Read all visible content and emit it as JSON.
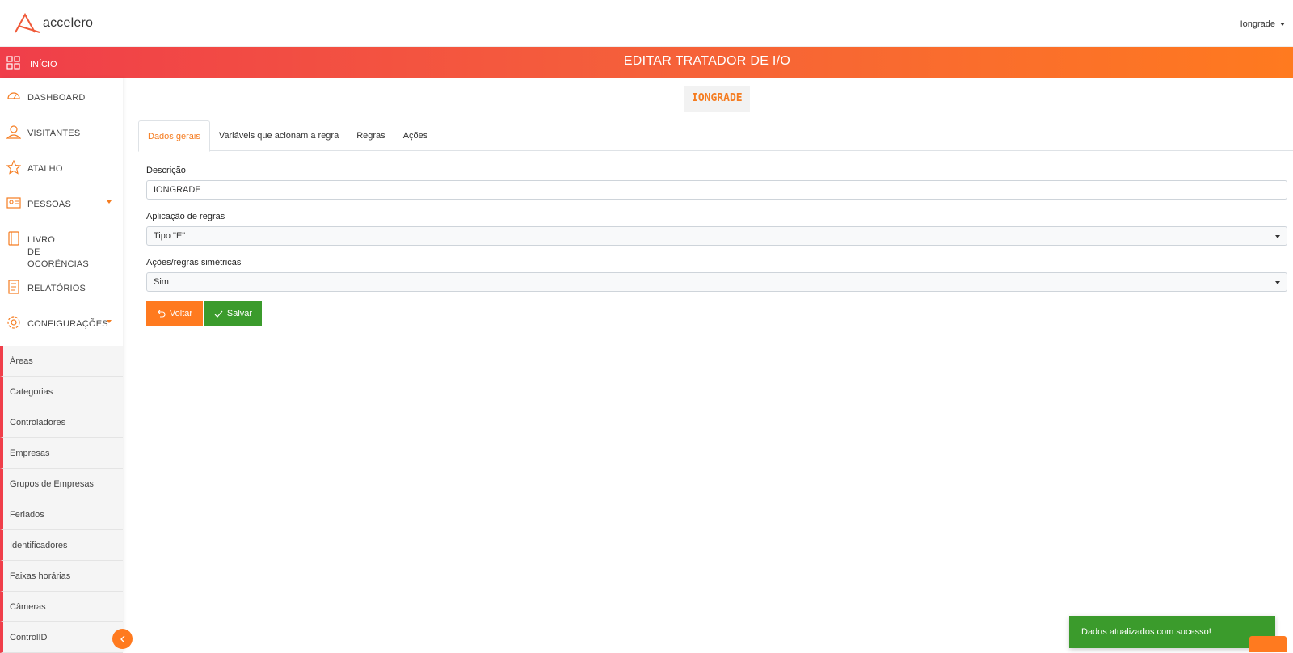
{
  "app": {
    "brand": "accelero",
    "user": "Iongrade"
  },
  "header": {
    "home_label": "INÍCIO",
    "page_title": "EDITAR TRATADOR DE I/O"
  },
  "sidebar": {
    "items": [
      {
        "label": "DASHBOARD",
        "icon": "dashboard-gauge-icon"
      },
      {
        "label": "VISITANTES",
        "icon": "person-icon"
      },
      {
        "label": "ATALHO",
        "icon": "star-icon"
      },
      {
        "label": "PESSOAS",
        "icon": "id-card-icon"
      },
      {
        "label": "LIVRO DE OCORÊNCIAS",
        "icon": "book-icon"
      },
      {
        "label": "RELATÓRIOS",
        "icon": "report-icon"
      },
      {
        "label": "CONFIGURAÇÕES",
        "icon": "gear-icon"
      }
    ],
    "submenu": [
      "Áreas",
      "Categorias",
      "Controladores",
      "Empresas",
      "Grupos de Empresas",
      "Feriados",
      "Identificadores",
      "Faixas horárias",
      "Câmeras",
      "ControlID"
    ]
  },
  "main": {
    "badge": "IONGRADE",
    "tabs": [
      "Dados gerais",
      "Variáveis que acionam a regra",
      "Regras",
      "Ações"
    ],
    "form": {
      "descricao_label": "Descrição",
      "descricao_value": "IONGRADE",
      "aplicacao_label": "Aplicação de regras",
      "aplicacao_value": "Tipo \"E\"",
      "acoes_label": "Ações/regras simétricas",
      "acoes_value": "Sim"
    },
    "buttons": {
      "back": "Voltar",
      "save": "Salvar"
    }
  },
  "toast": {
    "message": "Dados atualizados com sucesso!"
  },
  "colors": {
    "accent": "#ff7a1f",
    "red": "#f03e4a",
    "success": "#3b9b2c"
  }
}
